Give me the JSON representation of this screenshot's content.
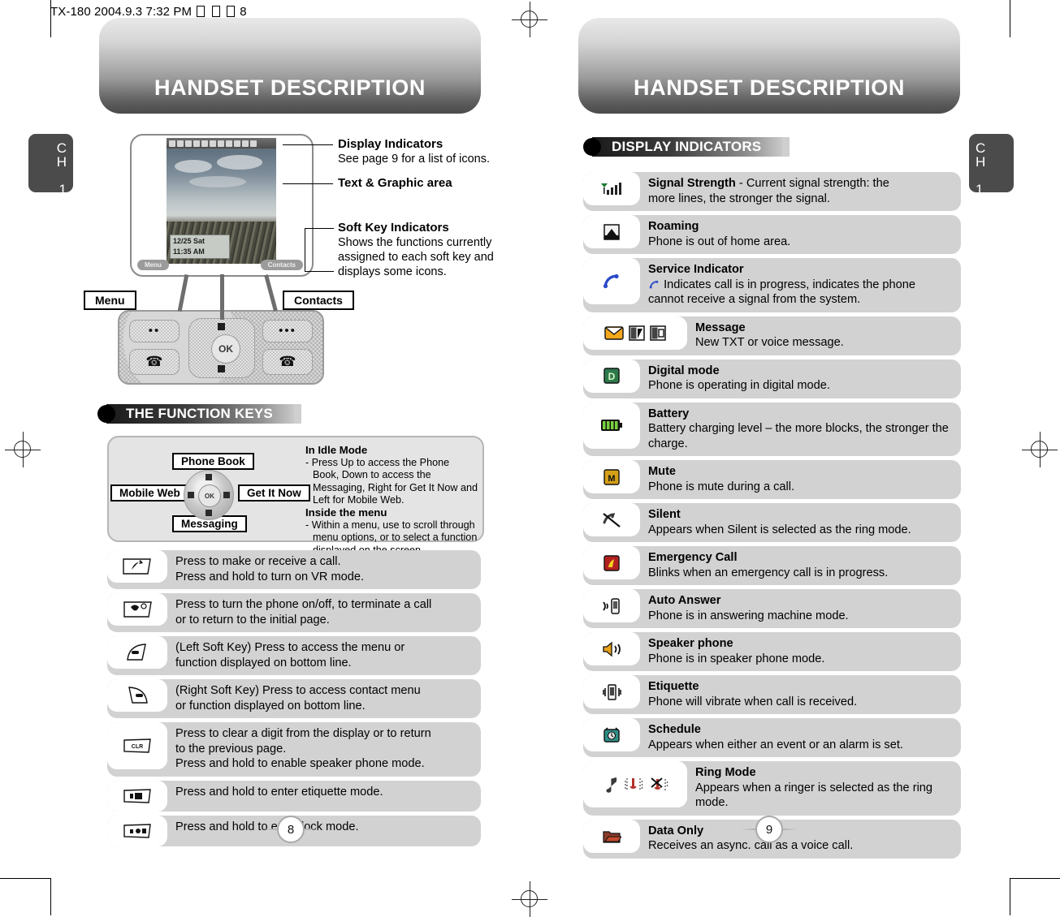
{
  "file_header": {
    "text_before": "TX-180  2004.9.3 7:32 PM",
    "unreadable_glyphs": 3,
    "text_after": "8"
  },
  "left_page": {
    "banner_title": "HANDSET DESCRIPTION",
    "chapter_tab": {
      "ch": "C",
      "ch2": "H",
      "number": "1"
    },
    "page_number": "8",
    "phone_display": {
      "date": "12/25 Sat",
      "time": "11:35 AM",
      "soft_left": "Menu",
      "soft_right": "Contacts"
    },
    "callouts": [
      {
        "label": "Menu"
      },
      {
        "label": "Contacts"
      }
    ],
    "annotations": [
      {
        "title": "Display Indicators",
        "desc": "See page 9 for a list of icons."
      },
      {
        "title": "Text & Graphic area",
        "desc": ""
      },
      {
        "title": "Soft Key Indicators",
        "desc": "Shows the functions currently assigned to each soft key and displays some icons."
      }
    ],
    "section_title": "THE FUNCTION KEYS",
    "nav_panel": {
      "labels": {
        "up": "Phone Book",
        "left": "Mobile Web",
        "right": "Get It Now",
        "down": "Messaging",
        "center": "OK"
      },
      "idle_heading": "In Idle Mode",
      "idle_body": "- Press Up to access the Phone Book, Down to access the Messaging, Right for Get It Now and Left for Mobile Web.",
      "menu_heading": "Inside the menu",
      "menu_body": "- Within a menu, use to scroll through menu options, or to select a function displayed on the screen."
    },
    "key_rows": [
      {
        "icon": "send-key-icon",
        "lines": [
          "Press to make or receive a call.",
          "Press and hold to turn on VR mode."
        ]
      },
      {
        "icon": "end-power-key-icon",
        "lines": [
          "Press to turn the phone on/off, to terminate a call",
          "or to return to the initial page."
        ]
      },
      {
        "icon": "left-soft-key-icon",
        "lines": [
          "(Left Soft Key) Press to access the menu or",
          "function displayed on bottom line."
        ]
      },
      {
        "icon": "right-soft-key-icon",
        "lines": [
          "(Right Soft Key) Press to access contact menu",
          "or function displayed on bottom line."
        ]
      },
      {
        "icon": "clear-key-icon",
        "lines": [
          "Press to clear a digit from the display or to return",
          "to the previous page.",
          "Press and hold to enable speaker phone mode."
        ]
      },
      {
        "icon": "etiquette-key-icon",
        "lines": [
          "Press and hold to enter etiquette mode."
        ]
      },
      {
        "icon": "lock-key-icon",
        "lines": [
          "Press and hold to enter lock mode."
        ]
      }
    ]
  },
  "right_page": {
    "banner_title": "HANDSET DESCRIPTION",
    "chapter_tab": {
      "ch": "C",
      "ch2": "H",
      "number": "1"
    },
    "page_number": "9",
    "section_title": "DISPLAY INDICATORS",
    "indicators": [
      {
        "icons": [
          "signal-strength-icon"
        ],
        "title": "Signal Strength",
        "title_suffix": " - Current signal strength: the",
        "desc": "more lines, the stronger the signal."
      },
      {
        "icons": [
          "roaming-icon"
        ],
        "title": "Roaming",
        "title_suffix": "",
        "desc": "Phone is out of home area."
      },
      {
        "icons": [
          "service-indicator-icon"
        ],
        "title": "Service Indicator",
        "title_suffix": "",
        "desc": "Indicates call is in progress,  indicates the phone cannot receive a signal from the system.",
        "inline_icons": [
          "call-in-progress-icon",
          "no-service-icon"
        ]
      },
      {
        "icons": [
          "message-envelope-icon",
          "text-message-icon",
          "voice-message-icon"
        ],
        "title": "Message",
        "title_suffix": "",
        "desc": "New TXT or voice message."
      },
      {
        "icons": [
          "digital-mode-icon"
        ],
        "title": "Digital mode",
        "title_suffix": "",
        "desc": "Phone is operating in digital mode."
      },
      {
        "icons": [
          "battery-icon"
        ],
        "title": "Battery",
        "title_suffix": "",
        "desc": "Battery charging level – the more blocks, the stronger the charge."
      },
      {
        "icons": [
          "mute-icon"
        ],
        "title": "Mute",
        "title_suffix": "",
        "desc": "Phone is mute during a call."
      },
      {
        "icons": [
          "silent-icon"
        ],
        "title": "Silent",
        "title_suffix": "",
        "desc": "Appears when Silent is selected as the ring mode."
      },
      {
        "icons": [
          "emergency-call-icon"
        ],
        "title": "Emergency Call",
        "title_suffix": "",
        "desc": "Blinks when an emergency call is in progress."
      },
      {
        "icons": [
          "auto-answer-icon"
        ],
        "title": "Auto Answer",
        "title_suffix": "",
        "desc": "Phone is in answering machine mode."
      },
      {
        "icons": [
          "speaker-phone-icon"
        ],
        "title": "Speaker phone",
        "title_suffix": "",
        "desc": "Phone is in speaker phone mode."
      },
      {
        "icons": [
          "etiquette-vibrate-icon"
        ],
        "title": "Etiquette",
        "title_suffix": "",
        "desc": "Phone will vibrate when call is received."
      },
      {
        "icons": [
          "schedule-alarm-icon"
        ],
        "title": "Schedule",
        "title_suffix": "",
        "desc": "Appears when either an event or an alarm is set."
      },
      {
        "icons": [
          "ring-note-icon",
          "ring-vibrate-icon",
          "ring-off-icon"
        ],
        "title": "Ring Mode",
        "title_suffix": "",
        "desc": "Appears when a ringer is selected as the ring mode."
      },
      {
        "icons": [
          "data-only-icon"
        ],
        "title": "Data Only",
        "title_suffix": "",
        "desc": "Receives an async. call as a voice call."
      }
    ]
  },
  "colors": {
    "row_bg": "#d2d2d2",
    "banner_dark": "#4b4b4b",
    "tab_bg": "#4b4b4b",
    "panel_bg": "#e4e4e4"
  }
}
